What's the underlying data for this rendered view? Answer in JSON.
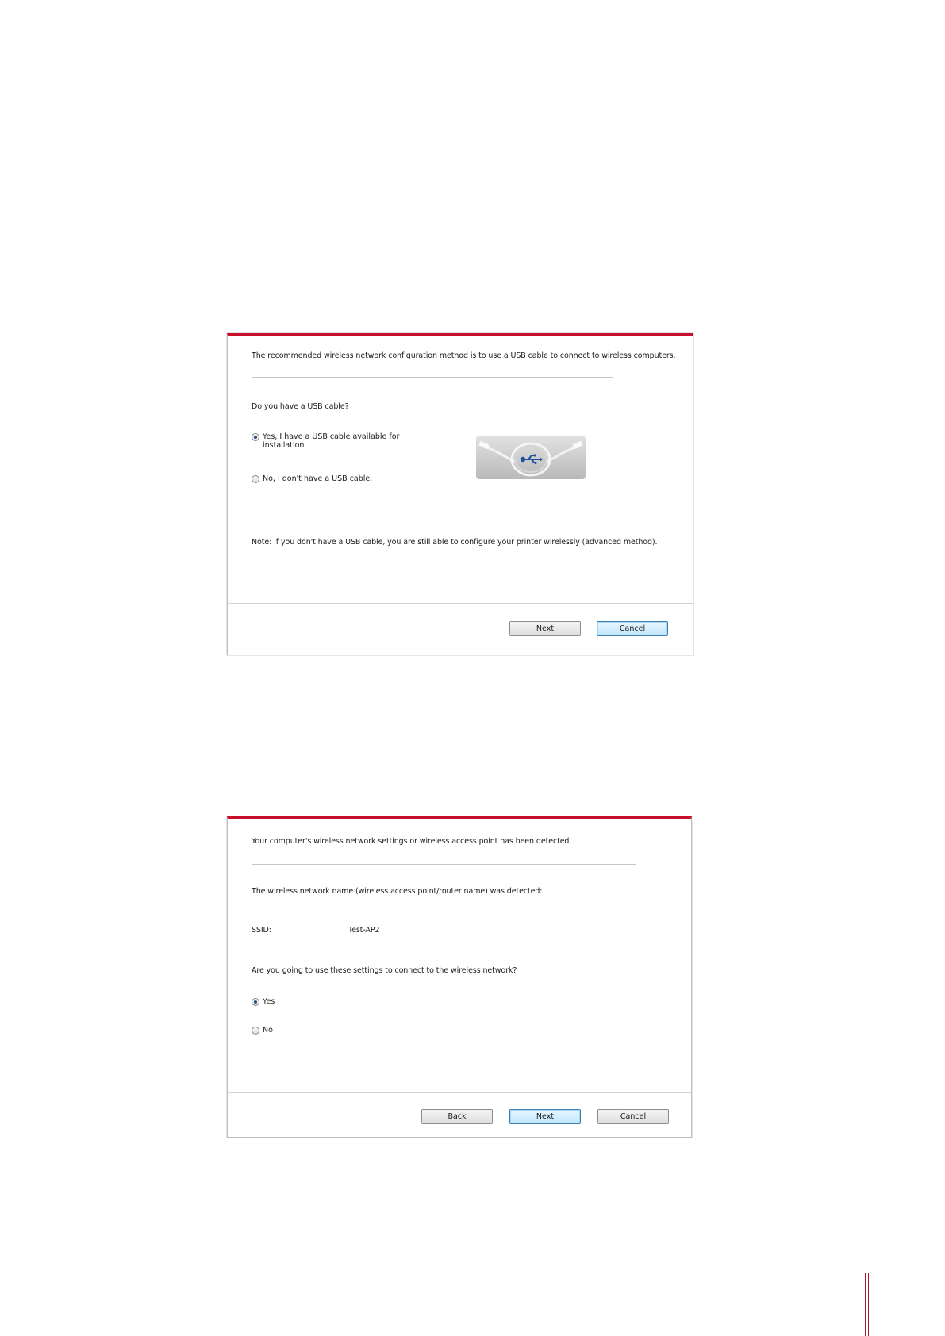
{
  "dialog1": {
    "intro": "The recommended wireless network configuration method is to use a USB cable to connect to wireless computers.",
    "question": "Do you have a USB cable?",
    "option_yes_line1": "Yes, I have a USB cable available for",
    "option_yes_line2": "installation.",
    "option_yes_selected": true,
    "option_no": "No, I don't have a USB cable.",
    "option_no_selected": false,
    "image": "usb-cable-image",
    "note": "Note:  If you don't have a USB cable, you are still able to configure your printer wirelessly (advanced method).",
    "next_label": "Next",
    "cancel_label": "Cancel",
    "default_button": "cancel"
  },
  "dialog2": {
    "intro": "Your computer's wireless network settings or wireless access point has been detected.",
    "detected_text": "The wireless network name (wireless access point/router name) was detected:",
    "ssid_label": "SSID:",
    "ssid_value": "Test-AP2",
    "question": "Are you going to use these settings to connect to the wireless network?",
    "option_yes": "Yes",
    "option_yes_selected": true,
    "option_no": "No",
    "option_no_selected": false,
    "back_label": "Back",
    "next_label": "Next",
    "cancel_label": "Cancel",
    "default_button": "next"
  },
  "colors": {
    "accent_red": "#c8102e",
    "default_button_border": "#3c7fb1",
    "usb_icon_blue": "#1f4fa0"
  }
}
